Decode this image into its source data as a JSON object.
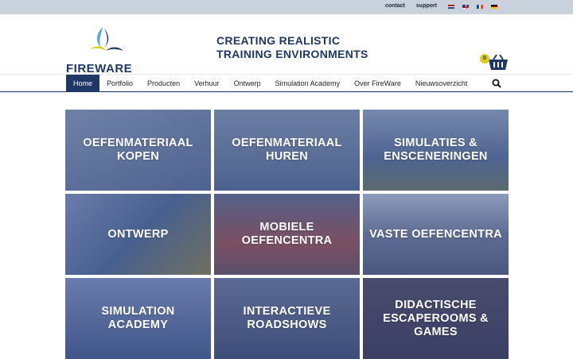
{
  "top_links": {
    "contact": "contact",
    "support": "support"
  },
  "languages": [
    "nl-flag-icon",
    "uk-flag-icon",
    "fr-flag-icon",
    "de-flag-icon"
  ],
  "brand": {
    "logo_text": "FIREWARE",
    "tagline_line1": "CREATING REALISTIC",
    "tagline_line2": "TRAINING ENVIRONMENTS",
    "primary_color": "#1e3765",
    "accent_yellow": "#dccc1b",
    "accent_lightblue": "#5aa9dd"
  },
  "basket": {
    "count": "0",
    "icon": "basket-icon"
  },
  "nav": {
    "items": [
      {
        "label": "Home",
        "active": true
      },
      {
        "label": "Portfolio",
        "active": false
      },
      {
        "label": "Producten",
        "active": false
      },
      {
        "label": "Verhuur",
        "active": false
      },
      {
        "label": "Ontwerp",
        "active": false
      },
      {
        "label": "Simulation Academy",
        "active": false
      },
      {
        "label": "Over FireWare",
        "active": false
      },
      {
        "label": "Nieuwsoverzicht",
        "active": false
      }
    ],
    "search_icon": "search-icon"
  },
  "tiles": [
    {
      "label": "OEFENMATERIAAL KOPEN",
      "bg": "#5a6e96"
    },
    {
      "label": "OEFENMATERIAAL HUREN",
      "bg": "#5d6f95"
    },
    {
      "label": "SIMULATIES & ENSCENERINGEN",
      "bg": "#5a6c92"
    },
    {
      "label": "ONTWERP",
      "bg": "#52689a"
    },
    {
      "label": "MOBIELE OEFENCENTRA",
      "bg": "#6a5870"
    },
    {
      "label": "VASTE OEFENCENTRA",
      "bg": "#5d6c92"
    },
    {
      "label": "SIMULATION ACADEMY",
      "bg": "#55689a"
    },
    {
      "label": "INTERACTIEVE ROADSHOWS",
      "bg": "#4f5f88"
    },
    {
      "label": "DIDACTISCHE ESCAPEROOMS & GAMES",
      "bg": "#4a4f72"
    }
  ]
}
